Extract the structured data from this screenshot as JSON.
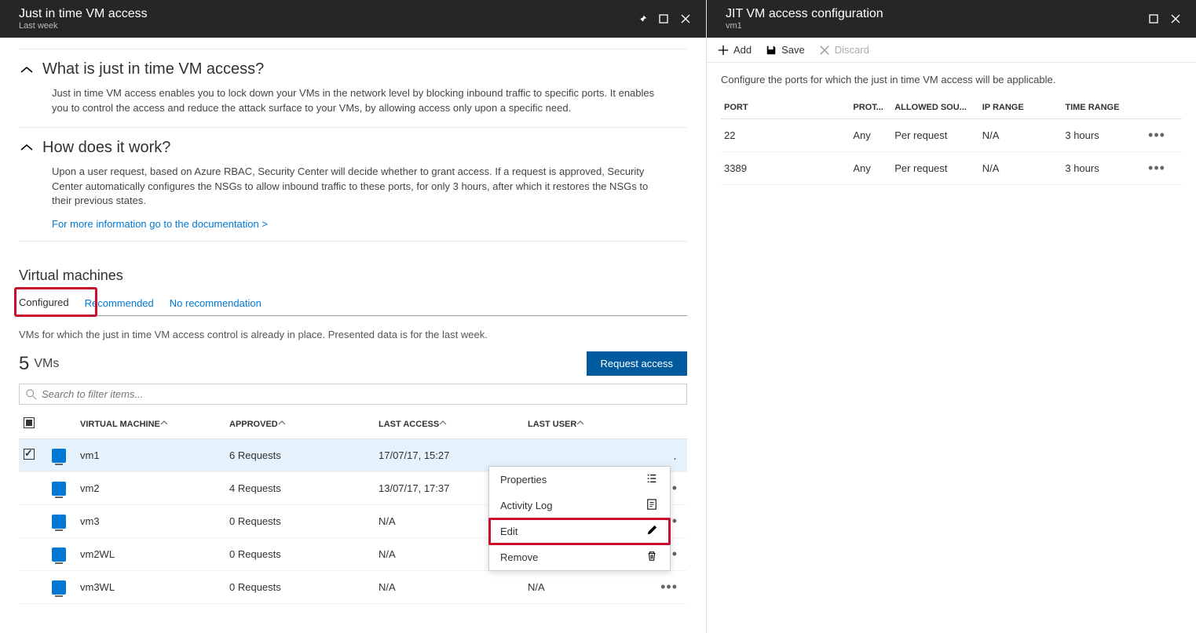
{
  "left": {
    "header": {
      "title": "Just in time VM access",
      "subtitle": "Last week"
    },
    "info1": {
      "heading": "What is just in time VM access?",
      "body": "Just in time VM access enables you to lock down your VMs in the network level by blocking inbound traffic to specific ports. It enables you to control the access and reduce the attack surface to your VMs, by allowing access only upon a specific need."
    },
    "info2": {
      "heading": "How does it work?",
      "body": "Upon a user request, based on Azure RBAC, Security Center will decide whether to grant access. If a request is approved, Security Center automatically configures the NSGs to allow inbound traffic to these ports, for only 3 hours, after which it restores the NSGs to their previous states.",
      "link": "For more information go to the documentation  >"
    },
    "vm_section_title": "Virtual machines",
    "tabs": {
      "configured": "Configured",
      "recommended": "Recommended",
      "norec": "No recommendation"
    },
    "tab_desc": "VMs for which the just in time VM access control is already in place. Presented data is for the last week.",
    "count": "5",
    "count_label": "VMs",
    "request_btn": "Request access",
    "search_placeholder": "Search to filter items...",
    "columns": {
      "vm": "VIRTUAL MACHINE",
      "approved": "APPROVED",
      "last_access": "LAST ACCESS",
      "last_user": "LAST USER"
    },
    "rows": [
      {
        "name": "vm1",
        "approved": "6 Requests",
        "last_access": "17/07/17, 15:27",
        "last_user": "",
        "selected": true
      },
      {
        "name": "vm2",
        "approved": "4 Requests",
        "last_access": "13/07/17, 17:37",
        "last_user": "",
        "selected": false
      },
      {
        "name": "vm3",
        "approved": "0 Requests",
        "last_access": "N/A",
        "last_user": "",
        "selected": false
      },
      {
        "name": "vm2WL",
        "approved": "0 Requests",
        "last_access": "N/A",
        "last_user": "",
        "selected": false
      },
      {
        "name": "vm3WL",
        "approved": "0 Requests",
        "last_access": "N/A",
        "last_user": "N/A",
        "selected": false
      }
    ],
    "context_menu": {
      "properties": "Properties",
      "activity": "Activity Log",
      "edit": "Edit",
      "remove": "Remove"
    }
  },
  "right": {
    "header": {
      "title": "JIT VM access configuration",
      "subtitle": "vm1"
    },
    "toolbar": {
      "add": "Add",
      "save": "Save",
      "discard": "Discard"
    },
    "desc": "Configure the ports for which the just in time VM access will be applicable.",
    "columns": {
      "port": "PORT",
      "protocol": "PROT...",
      "allowed": "ALLOWED SOU...",
      "iprange": "IP RANGE",
      "timerange": "TIME RANGE"
    },
    "rows": [
      {
        "port": "22",
        "protocol": "Any",
        "allowed": "Per request",
        "iprange": "N/A",
        "timerange": "3 hours"
      },
      {
        "port": "3389",
        "protocol": "Any",
        "allowed": "Per request",
        "iprange": "N/A",
        "timerange": "3 hours"
      }
    ]
  }
}
